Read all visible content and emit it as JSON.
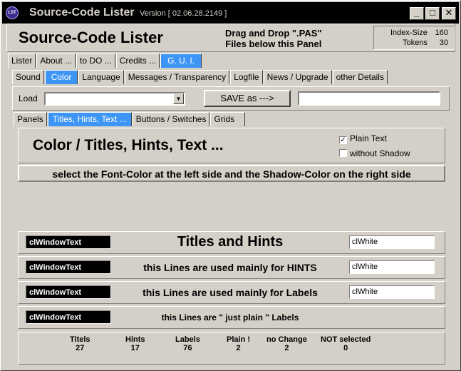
{
  "window": {
    "title": "Source-Code Lister",
    "version": "Version [ 02.06.28.2149 ]",
    "icon_label": "LST",
    "minimize_glyph": "_",
    "maximize_glyph": "□",
    "close_glyph": "✕"
  },
  "header": {
    "title": "Source-Code Lister",
    "dnd_line1": "Drag and Drop \".PAS\"",
    "dnd_line2": "Files below this Panel",
    "index_size_label": "Index-Size",
    "index_size_value": "160",
    "tokens_label": "Tokens",
    "tokens_value": "30"
  },
  "main_tabs": [
    {
      "label": "Lister"
    },
    {
      "label": "About ..."
    },
    {
      "label": "to DO ..."
    },
    {
      "label": "Credits ..."
    },
    {
      "label": "G. U. I."
    }
  ],
  "gui_tabs": [
    {
      "label": "Sound"
    },
    {
      "label": "Color"
    },
    {
      "label": "Language"
    },
    {
      "label": "Messages / Transparency"
    },
    {
      "label": "Logfile"
    },
    {
      "label": "News / Upgrade"
    },
    {
      "label": "other Details"
    }
  ],
  "load": {
    "label": "Load",
    "select_value": "",
    "save_button": "SAVE as --->",
    "save_name_value": ""
  },
  "color_tabs": [
    {
      "label": "Panels"
    },
    {
      "label": "Titles, Hints, Text ..."
    },
    {
      "label": "Buttons / Switches"
    },
    {
      "label": "Grids"
    }
  ],
  "color_panel": {
    "title": "Color / Titles, Hints,  Text ...",
    "plain_text_label": "Plain Text",
    "plain_text_checked": true,
    "without_shadow_label": "without Shadow",
    "without_shadow_checked": false,
    "instruction": "select the Font-Color at the left side and the Shadow-Color on the right side"
  },
  "rows": [
    {
      "font_color": "clWindowText",
      "label": "Titles and Hints",
      "shadow_color": "clWhite"
    },
    {
      "font_color": "clWindowText",
      "label": "this Lines are used mainly for HINTS",
      "shadow_color": "clWhite"
    },
    {
      "font_color": "clWindowText",
      "label": "this Lines are used mainly for Labels",
      "shadow_color": "clWhite"
    },
    {
      "font_color": "clWindowText",
      "label": "this Lines are \" just plain \" Labels",
      "shadow_color": ""
    }
  ],
  "stats": [
    {
      "label": "Titels",
      "value": "27"
    },
    {
      "label": "Hints",
      "value": "17"
    },
    {
      "label": "Labels",
      "value": "76"
    },
    {
      "label": "Plain !",
      "value": "2"
    },
    {
      "label": "no Change",
      "value": "2"
    },
    {
      "label": "NOT selected",
      "value": "0"
    }
  ],
  "colors": {
    "active_tab": "#3d95f5",
    "face": "#d4d0c8",
    "titlebar": "#000000"
  }
}
